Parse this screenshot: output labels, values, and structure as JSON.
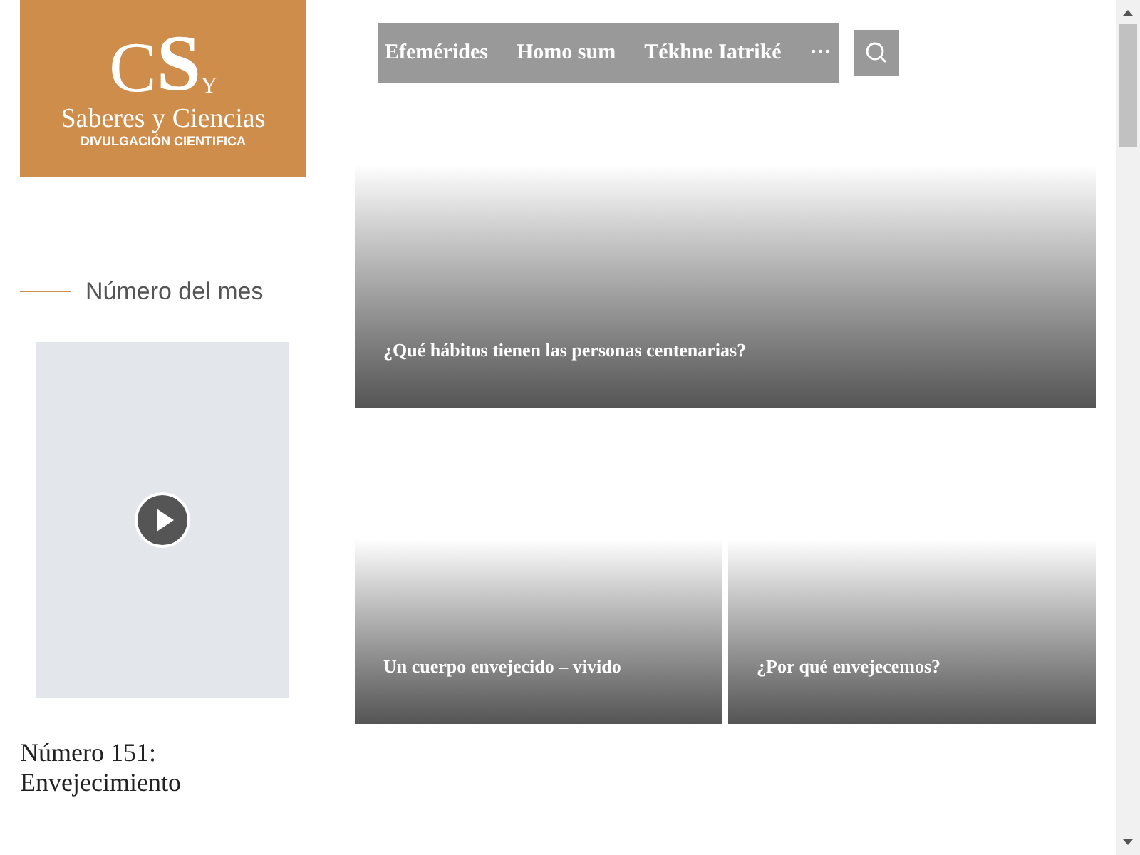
{
  "logo": {
    "monogram": [
      "C",
      "S",
      "Y"
    ],
    "name": "Saberes y Ciencias",
    "tagline": "DIVULGACIÓN CIENTIFICA"
  },
  "nav": {
    "items": [
      "Efemérides",
      "Homo sum",
      "Tékhne Iatriké",
      "···"
    ]
  },
  "sidebar": {
    "heading": "Número del mes",
    "issue_title": "Número 151: Envejecimiento"
  },
  "articles": [
    {
      "title": "¿Qué hábitos tienen las personas centenarias?"
    },
    {
      "title": "Un cuerpo envejecido – vivido"
    },
    {
      "title": "¿Por qué envejecemos?"
    }
  ]
}
